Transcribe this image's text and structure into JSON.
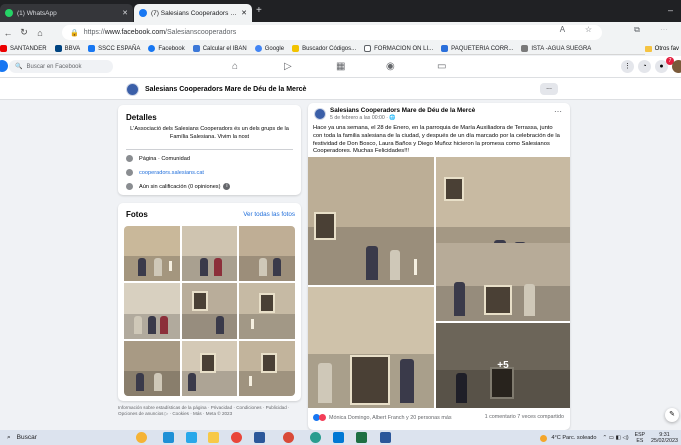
{
  "browser": {
    "tabs": [
      {
        "title": "(1) WhatsApp",
        "icon": "whatsapp-icon",
        "color": "#25d366"
      },
      {
        "title": "(7) Salesians Cooperadors Mare d",
        "icon": "facebook-icon",
        "color": "#1877f2"
      }
    ],
    "url_prefix": "https://",
    "url_host": "www.facebook.com",
    "url_path": "/Salesianscooperadors",
    "bookmarks": [
      {
        "label": "SANTANDER",
        "color": "#ec0000"
      },
      {
        "label": "BBVA",
        "color": "#004481"
      },
      {
        "label": "SSCC ESPAÑA",
        "color": "#1877f2"
      },
      {
        "label": "Facebook",
        "color": "#1877f2"
      },
      {
        "label": "Calcular el IBAN",
        "color": "#3c78d8"
      },
      {
        "label": "Google",
        "color": "#4285f4"
      },
      {
        "label": "Buscador Códigos...",
        "color": "#f2c300"
      },
      {
        "label": "FORMACION ON LI...",
        "color": "#5f6368"
      },
      {
        "label": "PAQUETERIA CORR...",
        "color": "#2a6fdb"
      },
      {
        "label": "ISTA -AGUA SUEGRA",
        "color": "#7a7a7a"
      }
    ],
    "other_bookmarks": "Otros fav"
  },
  "fb": {
    "search_placeholder": "Buscar en Facebook",
    "notifications_count": "7",
    "page_name": "Salesians Cooperadors Mare de Déu de la Mercè",
    "more_label": "..."
  },
  "details": {
    "heading": "Detalles",
    "intro": "L'Associació dels Salesians Cooperadors és un dels grups de la Família Salesiana. Vivim la nost",
    "category": "Página · Comunidad",
    "website": "cooperadors.salesians.cat",
    "rating": "Aún sin calificación (0 opiniones)"
  },
  "photos": {
    "heading": "Fotos",
    "see_all": "Ver todas las fotos"
  },
  "footer": "Información sobre estadísticas de la página · Privacidad · Condiciones · Publicidad · Opciones de anuncios ▷ · Cookies · Más · Meta © 2023",
  "post": {
    "author": "Salesians Cooperadors Mare de Déu de la Mercè",
    "date": "5 de febrero a las 00:00 · 🌐",
    "text": "Hace ya una semana, el 28 de Enero, en la parroquia de María Auxiliadora de Terrassa, junto con toda la familia salesiana de la ciudad, y después de un día marcado por la celebración de la festividad de Don Bosco, Laura Baños y Diego Muñoz hicieron la promesa como Salesianos Cooperadores. Muchas Felicidades!!!",
    "more_photos": "+5",
    "reactions": "Mónica Domingo, Albert Franch y 20 personas más",
    "counts": "1 comentario  7 veces compartido"
  },
  "taskbar": {
    "search": "Buscar",
    "weather": "4°C  Parc. soleado",
    "lang_top": "ESP",
    "lang_bottom": "ES",
    "time": "9:31",
    "date": "25/02/2023"
  }
}
